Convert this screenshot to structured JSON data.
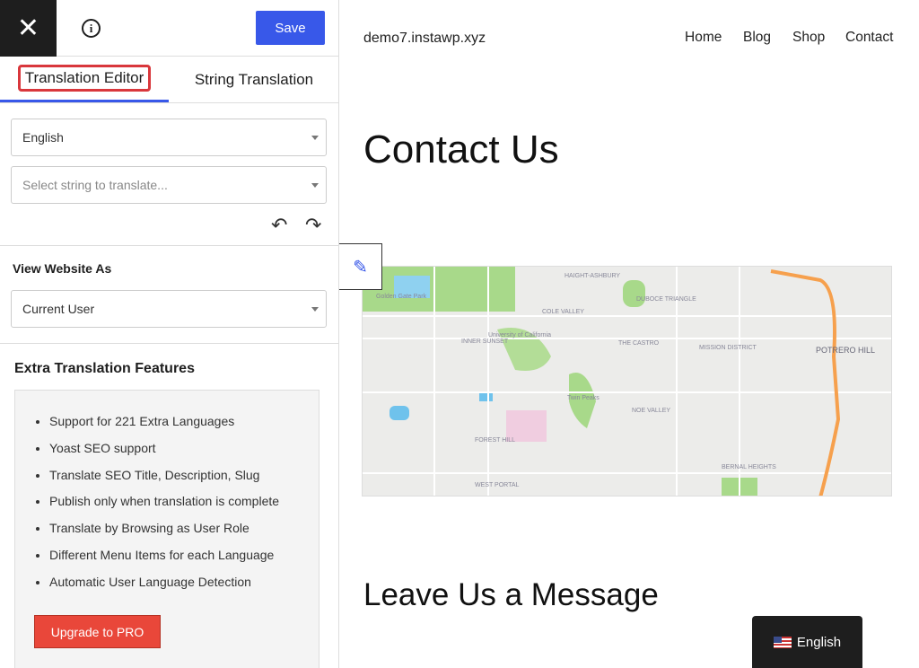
{
  "sidebar": {
    "close_icon": "close-icon",
    "info_icon": "info-icon",
    "save_label": "Save",
    "tabs": [
      {
        "label": "Translation Editor",
        "active": true
      },
      {
        "label": "String Translation",
        "active": false
      }
    ],
    "language_select": {
      "value": "English"
    },
    "string_select": {
      "placeholder": "Select string to translate..."
    },
    "undo_icon": "undo-icon",
    "redo_icon": "redo-icon",
    "view_as": {
      "heading": "View Website As",
      "value": "Current User"
    },
    "extra": {
      "heading": "Extra Translation Features",
      "items": [
        "Support for 221 Extra Languages",
        "Yoast SEO support",
        "Translate SEO Title, Description, Slug",
        "Publish only when translation is complete",
        "Translate by Browsing as User Role",
        "Different Menu Items for each Language",
        "Automatic User Language Detection"
      ],
      "upgrade_label": "Upgrade to PRO"
    },
    "accent": "#3858e9"
  },
  "site": {
    "brand": "demo7.instawp.xyz",
    "nav": [
      "Home",
      "Blog",
      "Shop",
      "Contact"
    ],
    "title": "Contact Us",
    "map_labels": [
      "Golden Gate Park",
      "HAIGHT-ASHBURY",
      "COLE VALLEY",
      "INNER SUNSET",
      "University of California",
      "THE CASTRO",
      "MISSION DISTRICT",
      "Twin Peaks",
      "NOE VALLEY",
      "FOREST HILL",
      "WEST PORTAL",
      "BERNAL HEIGHTS",
      "POTRERO HILL",
      "DUBOCE TRIANGLE"
    ],
    "section_title": "Leave Us a Message",
    "language_switcher": "English"
  }
}
